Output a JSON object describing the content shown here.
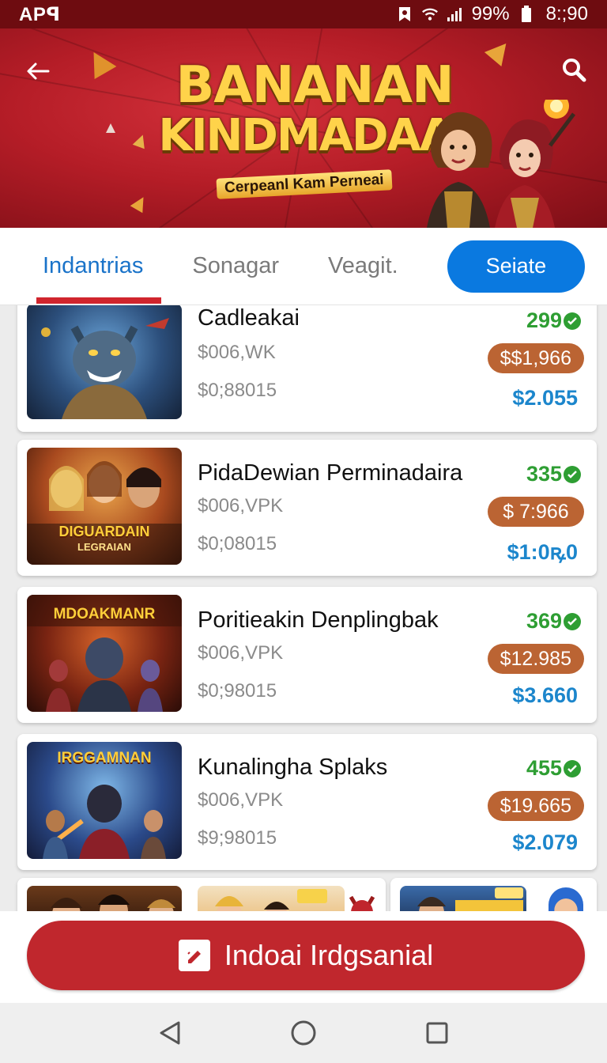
{
  "status_bar": {
    "app_label": "APꟼ",
    "battery": "99%",
    "time": "8:;90",
    "icons": [
      "notification-icon",
      "wifi-icon",
      "signal-icon",
      "battery-icon"
    ]
  },
  "hero": {
    "title_line1": "BANANAN",
    "title_line2": "KINDMADAA!",
    "subtitle": "Cerpeanl Kam Perneai",
    "back_icon": "back-arrow-icon",
    "search_icon": "search-icon"
  },
  "tabs": {
    "items": [
      {
        "label": "Indantrias",
        "active": true
      },
      {
        "label": "Sonagar",
        "active": false
      },
      {
        "label": "Veagit.",
        "active": false
      }
    ],
    "primary_button": "Seiate"
  },
  "games": [
    {
      "title": "Cadleakai",
      "meta1": "$006,WK",
      "meta2": "$0;88015",
      "score": "299",
      "price": "$$1,966",
      "alt_price": "$2.055"
    },
    {
      "title": "PidaDewian Perminadaira",
      "meta1": "$006,VPK",
      "meta2": "$0;08015",
      "score": "335",
      "price": "$ 7:966",
      "alt_price": "$1:0ꝶ0",
      "thumb_text_1": "DIGUARDAIN",
      "thumb_text_2": "LEGRAIAN"
    },
    {
      "title": "Poritieakin Denplingbak",
      "meta1": "$006,VPK",
      "meta2": "$0;98015",
      "score": "369",
      "price": "$12.985",
      "alt_price": "$3.660",
      "thumb_text_1": "MDOAKMANR"
    },
    {
      "title": "Kunalingha Splaks",
      "meta1": "$006,VPK",
      "meta2": "$9;98015",
      "score": "455",
      "price": "$19.665",
      "alt_price": "$2.079",
      "thumb_text_1": "IRGGAMNAN"
    }
  ],
  "cta": {
    "label": "Indoai Irdgsanial"
  },
  "colors": {
    "brand_red": "#c0272d",
    "primary_blue": "#0a79e0",
    "score_green": "#2e9e33",
    "price_orange": "#bb6433",
    "alt_price_blue": "#1c86cc"
  },
  "nav": [
    "back-triangle-icon",
    "home-circle-icon",
    "recents-square-icon"
  ]
}
